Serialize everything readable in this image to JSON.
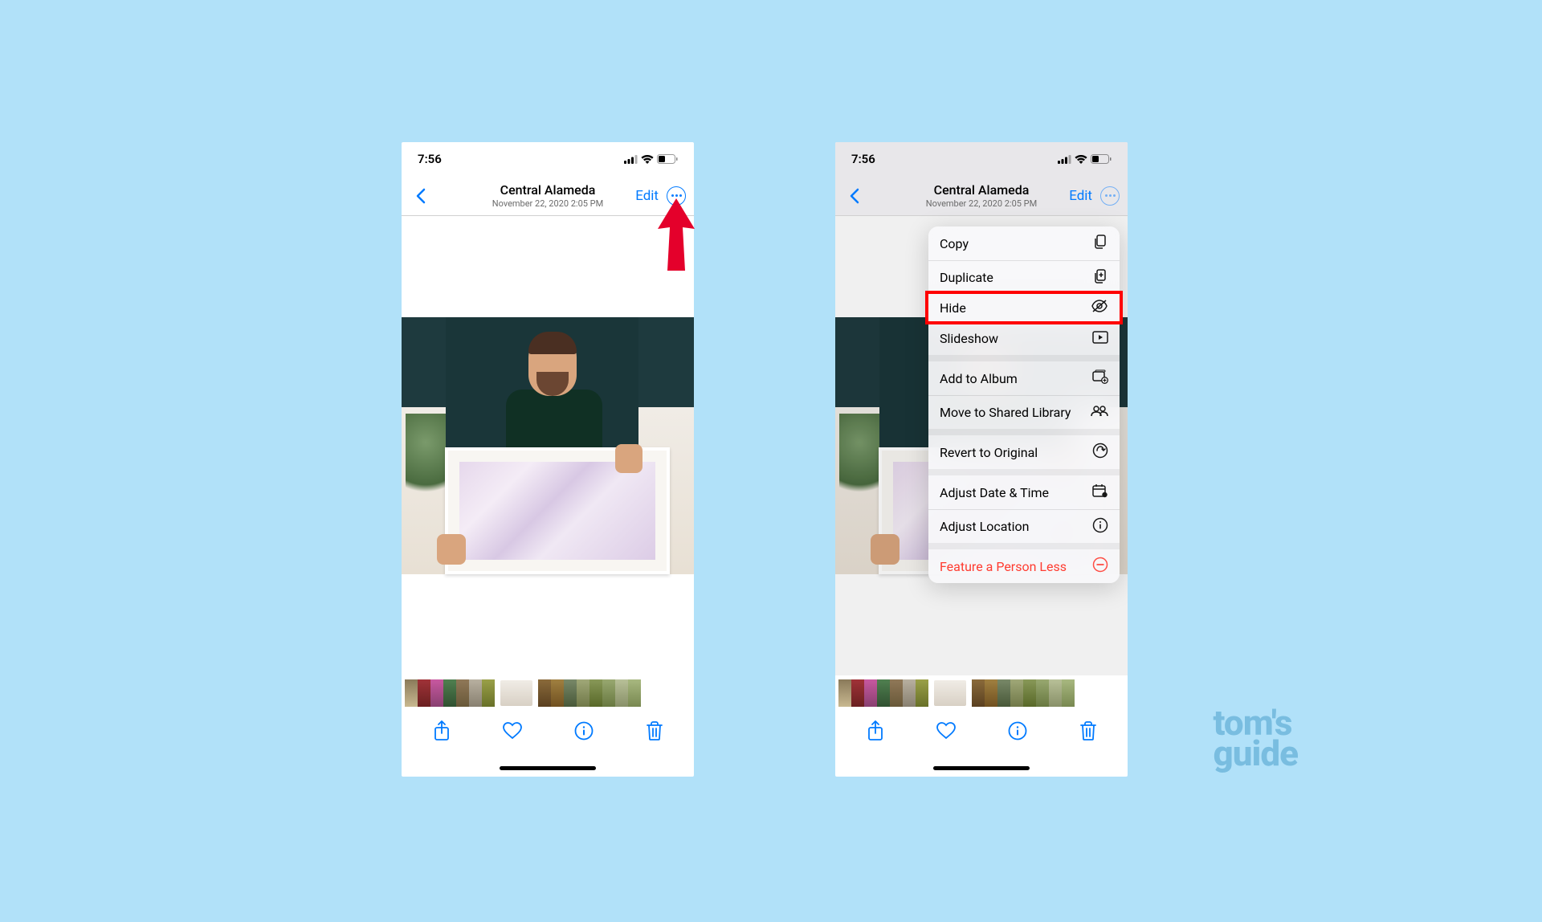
{
  "status": {
    "time": "7:56"
  },
  "nav": {
    "title": "Central Alameda",
    "subtitle": "November 22, 2020  2:05 PM",
    "edit": "Edit"
  },
  "menu": {
    "copy": "Copy",
    "duplicate": "Duplicate",
    "hide": "Hide",
    "slideshow": "Slideshow",
    "add_album": "Add to Album",
    "move_shared": "Move to Shared Library",
    "revert": "Revert to Original",
    "adjust_dt": "Adjust Date & Time",
    "adjust_loc": "Adjust Location",
    "feature_less": "Feature a Person Less"
  },
  "watermark": {
    "line1": "tom's",
    "line2": "guide"
  }
}
